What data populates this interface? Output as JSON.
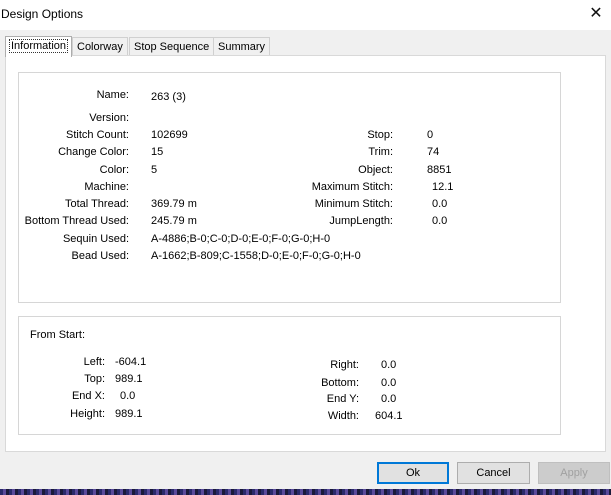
{
  "window": {
    "title": "Design Options",
    "close_glyph": "✕"
  },
  "tabs": [
    "Information",
    "Colorway",
    "Stop Sequence",
    "Summary"
  ],
  "info": {
    "name_label": "Name:",
    "name_value": "263 (3)",
    "version_label": "Version:",
    "version_value": "",
    "stitch_count_label": "Stitch Count:",
    "stitch_count_value": "102699",
    "change_color_label": "Change Color:",
    "change_color_value": "15",
    "color_label": "Color:",
    "color_value": "5",
    "machine_label": "Machine:",
    "machine_value": "",
    "total_thread_label": "Total Thread:",
    "total_thread_value": "369.79 m",
    "bottom_thread_label": "Bottom Thread Used:",
    "bottom_thread_value": "245.79 m",
    "sequin_label": "Sequin Used:",
    "sequin_value": "A-4886;B-0;C-0;D-0;E-0;F-0;G-0;H-0",
    "bead_label": "Bead Used:",
    "bead_value": "A-1662;B-809;C-1558;D-0;E-0;F-0;G-0;H-0",
    "stop_label": "Stop:",
    "stop_value": "0",
    "trim_label": "Trim:",
    "trim_value": "74",
    "object_label": "Object:",
    "object_value": "8851",
    "max_stitch_label": "Maximum Stitch:",
    "max_stitch_value": "12.1",
    "min_stitch_label": "Minimum Stitch:",
    "min_stitch_value": "0.0",
    "jump_length_label": "JumpLength:",
    "jump_length_value": "0.0"
  },
  "from_start": {
    "heading": "From Start:",
    "left_label": "Left:",
    "left_value": "-604.1",
    "top_label": "Top:",
    "top_value": "989.1",
    "endx_label": "End X:",
    "endx_value": "0.0",
    "height_label": "Height:",
    "height_value": "989.1",
    "right_label": "Right:",
    "right_value": "0.0",
    "bottom_label": "Bottom:",
    "bottom_value": "0.0",
    "endy_label": "End Y:",
    "endy_value": "0.0",
    "width_label": "Width:",
    "width_value": "604.1"
  },
  "buttons": {
    "ok": "Ok",
    "cancel": "Cancel",
    "apply": "Apply"
  }
}
